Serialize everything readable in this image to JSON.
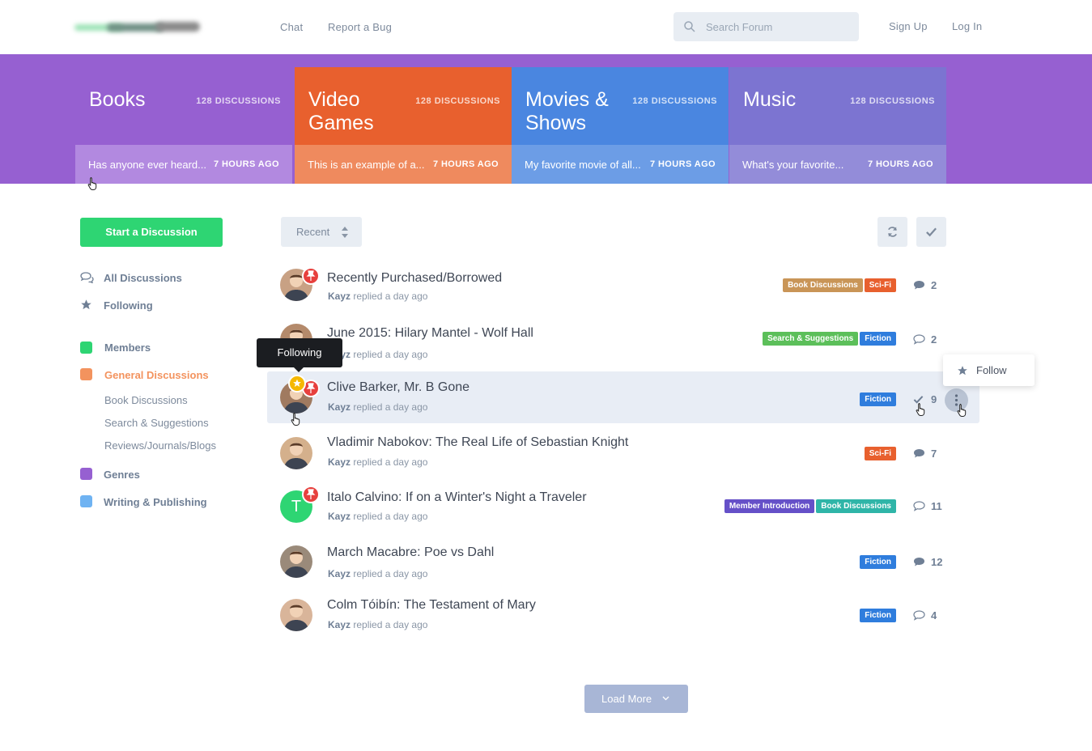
{
  "header": {
    "nav": [
      {
        "label": "Chat"
      },
      {
        "label": "Report a Bug"
      }
    ],
    "search_placeholder": "Search Forum",
    "sign_up": "Sign Up",
    "log_in": "Log In"
  },
  "categories": [
    {
      "title": "Books",
      "count": "128 DISCUSSIONS",
      "last": "Has anyone ever heard...",
      "time": "7 HOURS AGO",
      "color": "#9660d1",
      "foot": "#b289e0"
    },
    {
      "title": "Video Games",
      "count": "128 DISCUSSIONS",
      "last": "This is an example of a...",
      "time": "7 HOURS AGO",
      "color": "#e8602e",
      "foot": "#ef8a5e"
    },
    {
      "title": "Movies & Shows",
      "count": "128 DISCUSSIONS",
      "last": "My favorite movie of all...",
      "time": "7 HOURS AGO",
      "color": "#4a86e0",
      "foot": "#6c9de6"
    },
    {
      "title": "Music",
      "count": "128 DISCUSSIONS",
      "last": "What's your favorite...",
      "time": "7 HOURS AGO",
      "color": "#7c74d1",
      "foot": "#938cd9"
    }
  ],
  "sidebar": {
    "start_button": "Start a Discussion",
    "all_discussions": "All Discussions",
    "following": "Following",
    "tags": [
      {
        "label": "Members",
        "color": "#2ed573"
      },
      {
        "label": "General Discussions",
        "color": "#f3935e"
      },
      {
        "label": "Genres",
        "color": "#9660d1"
      },
      {
        "label": "Writing & Publishing",
        "color": "#6fb3f2"
      }
    ],
    "subtags": [
      "Book Discussions",
      "Search & Suggestions",
      "Reviews/Journals/Blogs"
    ]
  },
  "toolbar": {
    "sort": "Recent"
  },
  "discussions": [
    {
      "title": "Recently Purchased/Borrowed",
      "author": "Kayz",
      "reply": "replied a day ago",
      "tags": [
        {
          "label": "Book Discussions",
          "color": "#c99557"
        },
        {
          "label": "Sci-Fi",
          "color": "#e8602e"
        }
      ],
      "count": "2",
      "pinned": true
    },
    {
      "title": "June 2015: Hilary Mantel - Wolf Hall",
      "author": "Kayz",
      "reply": "replied a day ago",
      "tags": [
        {
          "label": "Search & Suggestions",
          "color": "#5cbf5a"
        },
        {
          "label": "Fiction",
          "color": "#2f7ddd"
        }
      ],
      "count": "2",
      "pinned": false
    },
    {
      "title": "Clive Barker, Mr. B Gone",
      "author": "Kayz",
      "reply": "replied a day ago",
      "tags": [
        {
          "label": "Fiction",
          "color": "#2f7ddd"
        }
      ],
      "count": "9",
      "pinned": true
    },
    {
      "title": "Vladimir Nabokov: The Real Life of Sebastian Knight",
      "author": "Kayz",
      "reply": "replied a day ago",
      "tags": [
        {
          "label": "Sci-Fi",
          "color": "#e8602e"
        }
      ],
      "count": "7",
      "pinned": false
    },
    {
      "title": "Italo Calvino: If on a Winter's Night a Traveler",
      "author": "Kayz",
      "reply": "replied a day ago",
      "tags": [
        {
          "label": "Member Introduction",
          "color": "#6550c8"
        },
        {
          "label": "Book Discussions",
          "color": "#2fb5a8"
        }
      ],
      "count": "11",
      "pinned": true,
      "initial": "T"
    },
    {
      "title": "March Macabre: Poe vs Dahl",
      "author": "Kayz",
      "reply": "replied a day ago",
      "tags": [
        {
          "label": "Fiction",
          "color": "#2f7ddd"
        }
      ],
      "count": "12",
      "pinned": false
    },
    {
      "title": "Colm Tóibín: The Testament of Mary",
      "author": "Kayz",
      "reply": "replied a day ago",
      "tags": [
        {
          "label": "Fiction",
          "color": "#2f7ddd"
        }
      ],
      "count": "4",
      "pinned": false
    }
  ],
  "tooltip": "Following",
  "dropdown": {
    "follow": "Follow"
  },
  "load_more": "Load More"
}
